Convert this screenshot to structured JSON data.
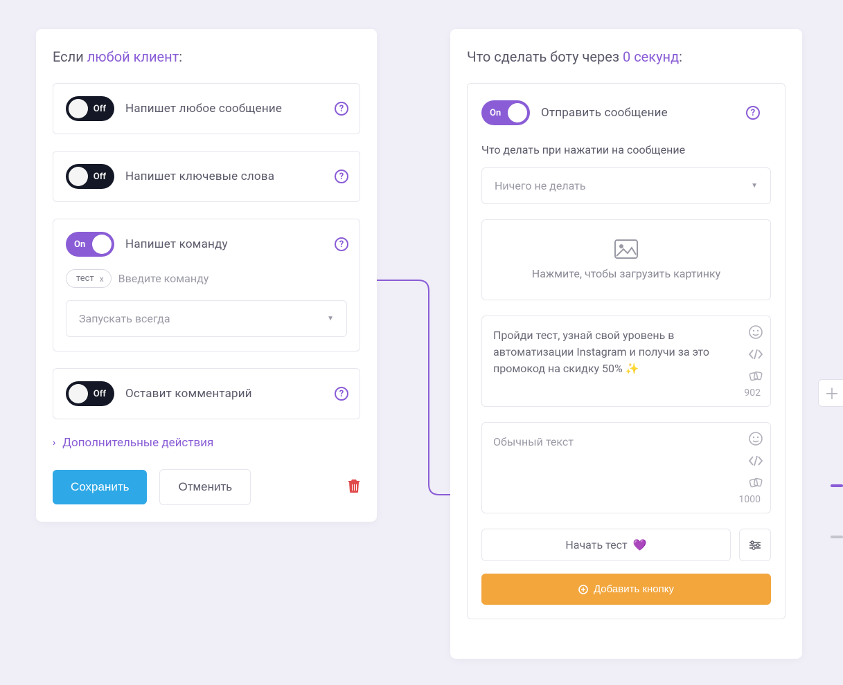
{
  "left": {
    "header_prefix": "Если",
    "header_accent": "любой клиент",
    "rows": [
      {
        "state": "off",
        "label": "Off",
        "text": "Напишет любое сообщение"
      },
      {
        "state": "off",
        "label": "Off",
        "text": "Напишет ключевые слова"
      },
      {
        "state": "on",
        "label": "On",
        "text": "Напишет команду"
      },
      {
        "state": "off",
        "label": "Off",
        "text": "Оставит комментарий"
      }
    ],
    "command": {
      "chip": "тест",
      "placeholder": "Введите команду",
      "run_mode": "Запускать всегда"
    },
    "extra_actions": "Дополнительные действия",
    "buttons": {
      "save": "Сохранить",
      "cancel": "Отменить"
    }
  },
  "right": {
    "header_prefix": "Что сделать боту через",
    "header_accent": "0 секунд",
    "send": {
      "state": "On",
      "label": "Отправить сообщение"
    },
    "click_label": "Что делать при нажатии на сообщение",
    "click_option": "Ничего не делать",
    "upload": "Нажмите, чтобы загрузить картинку",
    "msg1": {
      "text": "Пройди тест, узнай свой уровень в автоматизации Instagram и получи за это промокод на скидку 50% ✨",
      "count": "902"
    },
    "msg2": {
      "placeholder": "Обычный текст",
      "count": "1000"
    },
    "cta": "Начать тест",
    "cta_heart": "💜",
    "add_button": "Добавить кнопку"
  }
}
